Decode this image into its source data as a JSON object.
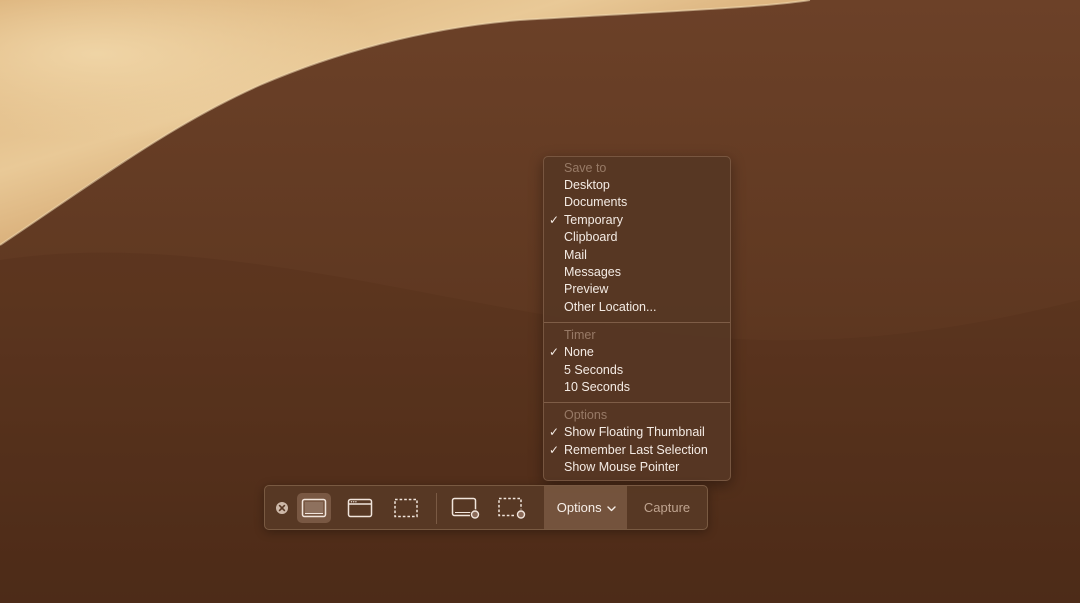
{
  "menu": {
    "sections": [
      {
        "header": "Save to",
        "items": [
          {
            "label": "Desktop",
            "checked": false
          },
          {
            "label": "Documents",
            "checked": false
          },
          {
            "label": "Temporary",
            "checked": true
          },
          {
            "label": "Clipboard",
            "checked": false
          },
          {
            "label": "Mail",
            "checked": false
          },
          {
            "label": "Messages",
            "checked": false
          },
          {
            "label": "Preview",
            "checked": false
          },
          {
            "label": "Other Location...",
            "checked": false
          }
        ]
      },
      {
        "header": "Timer",
        "items": [
          {
            "label": "None",
            "checked": true
          },
          {
            "label": "5 Seconds",
            "checked": false
          },
          {
            "label": "10 Seconds",
            "checked": false
          }
        ]
      },
      {
        "header": "Options",
        "items": [
          {
            "label": "Show Floating Thumbnail",
            "checked": true
          },
          {
            "label": "Remember Last Selection",
            "checked": true
          },
          {
            "label": "Show Mouse Pointer",
            "checked": false
          }
        ]
      }
    ],
    "check_glyph": "✓"
  },
  "toolbar": {
    "close_icon": "close-circle-icon",
    "tools": [
      {
        "name": "capture-entire-screen",
        "icon": "screen-icon",
        "selected": true
      },
      {
        "name": "capture-selected-window",
        "icon": "window-icon",
        "selected": false
      },
      {
        "name": "capture-selected-portion",
        "icon": "selection-icon",
        "selected": false
      },
      {
        "name": "record-entire-screen",
        "icon": "screen-record-icon",
        "selected": false
      },
      {
        "name": "record-selected-portion",
        "icon": "selection-record-icon",
        "selected": false
      }
    ],
    "options_label": "Options",
    "capture_label": "Capture"
  },
  "colors": {
    "wallpaper_dark": "#5e3820",
    "wallpaper_light": "#e8c48f",
    "menu_bg": "#563724",
    "toolbar_bg": "#583925"
  }
}
